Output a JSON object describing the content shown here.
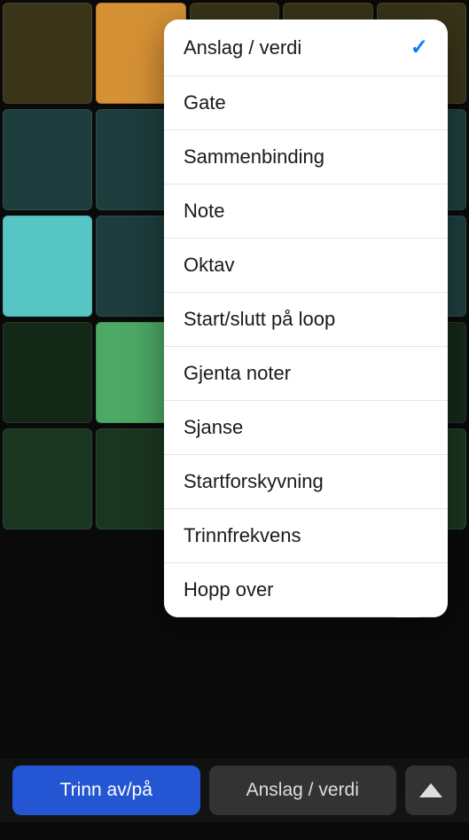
{
  "popup": {
    "items": [
      {
        "label": "Anslag / verdi",
        "selected": true
      },
      {
        "label": "Gate",
        "selected": false
      },
      {
        "label": "Sammenbinding",
        "selected": false
      },
      {
        "label": "Note",
        "selected": false
      },
      {
        "label": "Oktav",
        "selected": false
      },
      {
        "label": "Start/slutt på loop",
        "selected": false
      },
      {
        "label": "Gjenta noter",
        "selected": false
      },
      {
        "label": "Sjanse",
        "selected": false
      },
      {
        "label": "Startforskyvning",
        "selected": false
      },
      {
        "label": "Trinnfrekvens",
        "selected": false
      },
      {
        "label": "Hopp over",
        "selected": false
      }
    ]
  },
  "bottomBar": {
    "primaryLabel": "Trinn av/på",
    "secondaryLabel": "Anslag / verdi"
  }
}
